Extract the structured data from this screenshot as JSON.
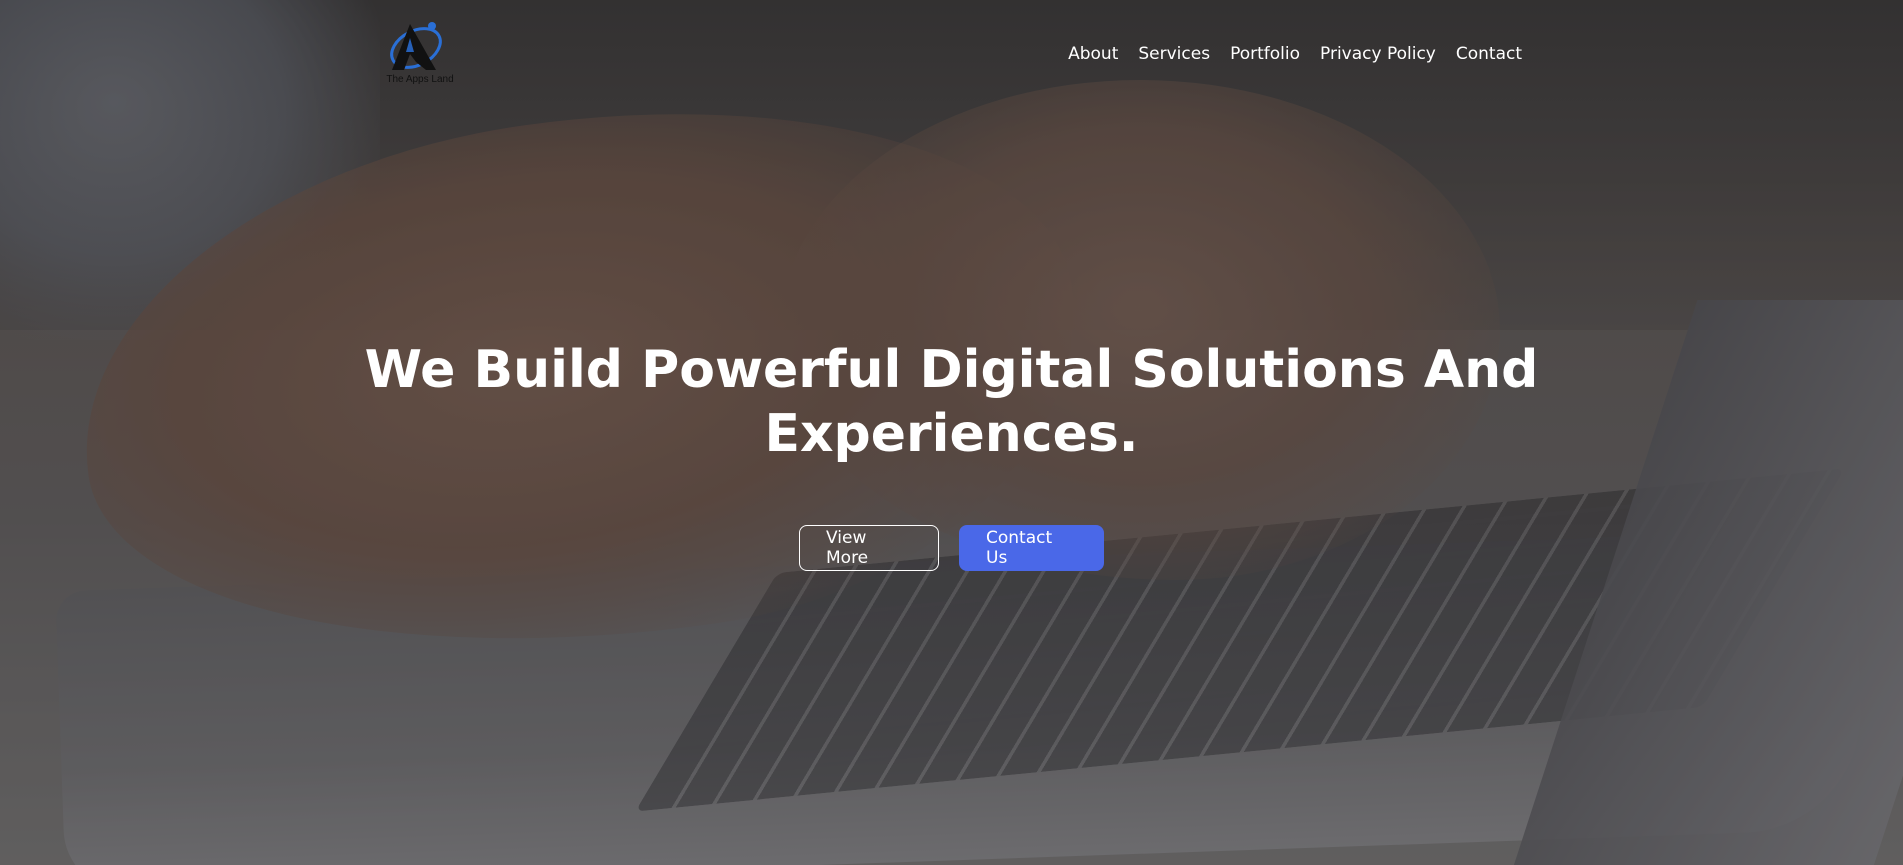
{
  "brand": {
    "logo_text": "The Apps Land",
    "colors": {
      "accent": "#4a68e8",
      "logo_dark": "#111111",
      "logo_blue": "#2a6fd6"
    }
  },
  "nav": {
    "items": [
      {
        "label": "About"
      },
      {
        "label": "Services"
      },
      {
        "label": "Portfolio"
      },
      {
        "label": "Privacy Policy"
      },
      {
        "label": "Contact"
      }
    ]
  },
  "hero": {
    "title_line1": "We Build Powerful Digital Solutions And",
    "title_line2": "Experiences.",
    "buttons": {
      "view_more": "View More",
      "contact_us": "Contact Us"
    }
  }
}
